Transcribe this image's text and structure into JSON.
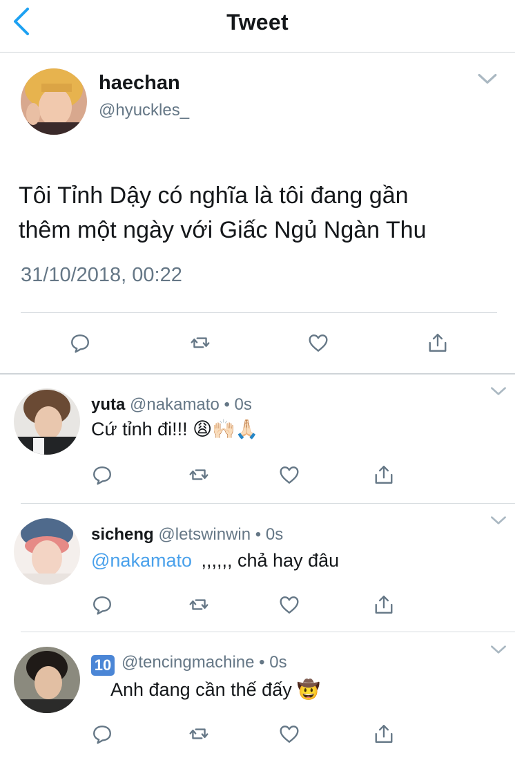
{
  "header": {
    "title": "Tweet"
  },
  "tweet": {
    "name": "haechan",
    "handle": "@hyuckles_",
    "text_line1": "Tôi Tỉnh Dậy có nghĩa là tôi đang gần",
    "text_line2": "thêm một ngày với Giấc Ngủ Ngàn Thu",
    "datetime": "31/10/2018, 00:22"
  },
  "replies": [
    {
      "name": "yuta",
      "handle": "@nakamato",
      "dot": "•",
      "time": "0s",
      "text": "Cứ tỉnh đi!!! 😩🙌🏻🙏🏻"
    },
    {
      "name": "sicheng",
      "handle": "@letswinwin",
      "dot": "•",
      "time": "0s",
      "mention": "@nakamato",
      "text": ",,,,,, chả hay đâu"
    },
    {
      "badge": "10",
      "handle": "@tencingmachine",
      "dot": "•",
      "time": "0s",
      "text": "Anh đang cần thế đấy 🤠"
    }
  ],
  "icons": [
    "back-chevron-icon",
    "chevron-down-icon",
    "reply-icon",
    "retweet-icon",
    "like-icon",
    "share-icon"
  ],
  "colors": {
    "text": "#14171a",
    "secondary": "#657786",
    "accent": "#1da1f2",
    "mention": "#4aa1eb",
    "icon": "#657786",
    "divider": "#cfd4d8"
  }
}
